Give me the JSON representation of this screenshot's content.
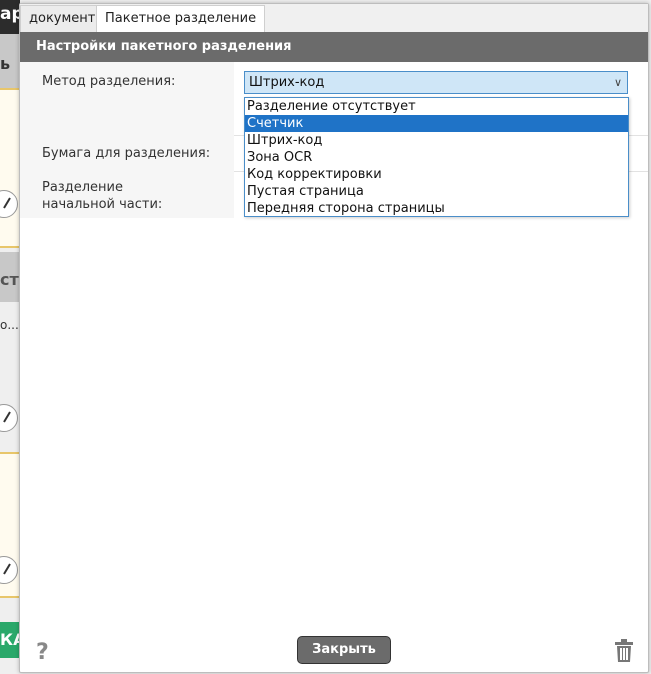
{
  "background_app": {
    "topbar_text": "ар",
    "header1_text": "ь",
    "header2_text": "ст",
    "truncated_text": "о...",
    "green_button_text": "КА"
  },
  "dialog": {
    "tabs": [
      {
        "label": "документ",
        "active": false
      },
      {
        "label": "Пакетное разделение",
        "active": true
      }
    ],
    "section_title": "Настройки пакетного разделения",
    "rows": {
      "method_label": "Метод разделения:",
      "paper_label": "Бумага для разделения:",
      "start_label": "Разделение начальной части:"
    },
    "method_select": {
      "value": "Штрих-код",
      "options": [
        "Разделение отсутствует",
        "Счетчик",
        "Штрих-код",
        "Зона OCR",
        "Код корректировки",
        "Пустая страница",
        "Передняя сторона страницы"
      ],
      "highlighted_option": "Счетчик"
    },
    "footer": {
      "help_icon": "question-mark-icon",
      "close_label": "Закрыть",
      "delete_icon": "trash-icon"
    }
  },
  "colors": {
    "section_header_bg": "#6b6b6b",
    "select_bg": "#cfe6f7",
    "select_border": "#4a8ec9",
    "highlight": "#1f73c7",
    "button_bg": "#6b6b6b"
  }
}
